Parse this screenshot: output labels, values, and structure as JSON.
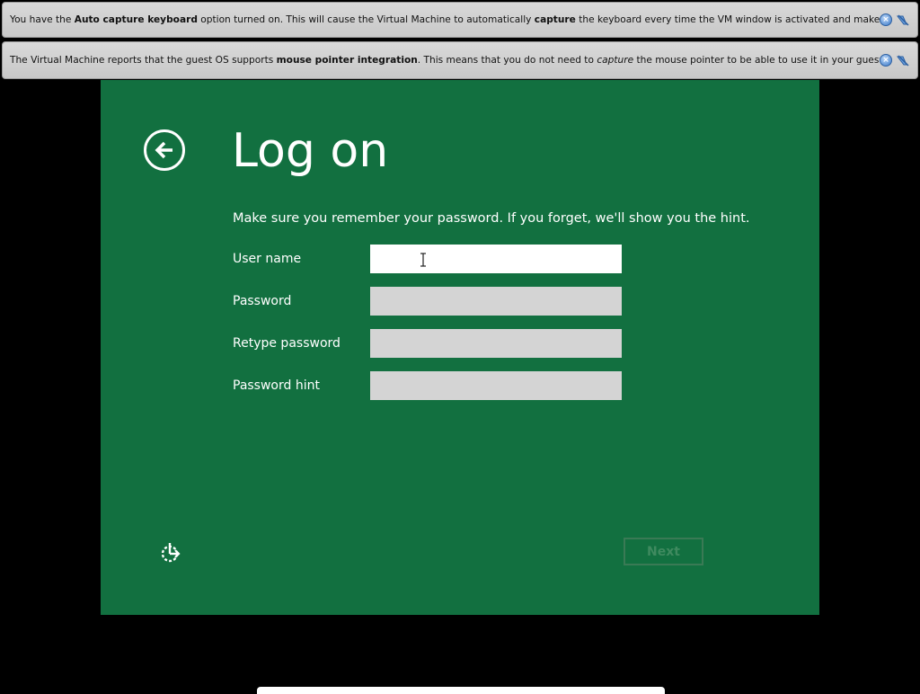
{
  "notices": [
    {
      "parts": [
        {
          "text": "You have the ",
          "style": "normal"
        },
        {
          "text": "Auto capture keyboard",
          "style": "bold"
        },
        {
          "text": " option turned on. This will cause the Virtual Machine to automatically ",
          "style": "normal"
        },
        {
          "text": "capture",
          "style": "bold"
        },
        {
          "text": " the keyboard every time the VM window is activated and make it unavailable to",
          "style": "normal"
        }
      ]
    },
    {
      "parts": [
        {
          "text": "The Virtual Machine reports that the guest OS supports ",
          "style": "normal"
        },
        {
          "text": "mouse pointer integration",
          "style": "bold"
        },
        {
          "text": ". This means that you do not need to ",
          "style": "normal"
        },
        {
          "text": "capture",
          "style": "italic"
        },
        {
          "text": " the mouse pointer to be able to use it in your guest OS -- all mouse",
          "style": "normal"
        }
      ]
    }
  ],
  "setup": {
    "title": "Log on",
    "instructions": "Make sure you remember your password. If you forget, we'll show you the hint.",
    "fields": {
      "user_name": {
        "label": "User name",
        "value": ""
      },
      "password": {
        "label": "Password",
        "value": ""
      },
      "retype_password": {
        "label": "Retype password",
        "value": ""
      },
      "password_hint": {
        "label": "Password hint",
        "value": ""
      }
    },
    "next_label": "Next"
  },
  "colors": {
    "setup_background": "#127040",
    "next_disabled": "#3f8a5f"
  },
  "icons": {
    "back": "back-arrow-circle-icon",
    "ease_of_access": "ease-of-access-icon",
    "close": "close-icon",
    "mute": "mute-notifications-icon"
  }
}
